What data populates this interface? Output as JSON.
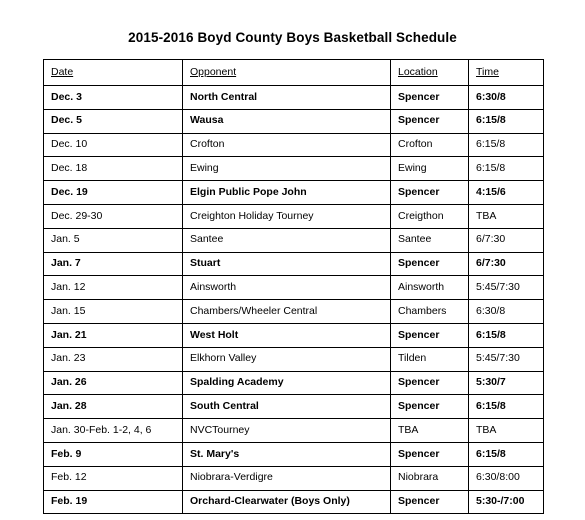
{
  "document": {
    "title": "2015-2016 Boyd County Boys Basketball Schedule"
  },
  "table": {
    "columns": [
      {
        "key": "date",
        "label": "Date"
      },
      {
        "key": "opponent",
        "label": "Opponent"
      },
      {
        "key": "location",
        "label": "Location"
      },
      {
        "key": "time",
        "label": "Time"
      }
    ],
    "rows": [
      {
        "date": "Dec. 3",
        "opponent": "North Central",
        "location": "Spencer",
        "time": "6:30/8",
        "home": true
      },
      {
        "date": "Dec. 5",
        "opponent": "Wausa",
        "location": "Spencer",
        "time": "6:15/8",
        "home": true
      },
      {
        "date": "Dec. 10",
        "opponent": "Crofton",
        "location": "Crofton",
        "time": "6:15/8",
        "home": false
      },
      {
        "date": "Dec. 18",
        "opponent": "Ewing",
        "location": "Ewing",
        "time": "6:15/8",
        "home": false
      },
      {
        "date": "Dec. 19",
        "opponent": "Elgin Public Pope John",
        "location": "Spencer",
        "time": "4:15/6",
        "home": true
      },
      {
        "date": "Dec. 29-30",
        "opponent": "Creighton Holiday Tourney",
        "location": "Creigthon",
        "time": "TBA",
        "home": false
      },
      {
        "date": "Jan. 5",
        "opponent": "Santee",
        "location": "Santee",
        "time": "6/7:30",
        "home": false
      },
      {
        "date": "Jan. 7",
        "opponent": "Stuart",
        "location": "Spencer",
        "time": "6/7:30",
        "home": true
      },
      {
        "date": "Jan. 12",
        "opponent": "Ainsworth",
        "location": "Ainsworth",
        "time": "5:45/7:30",
        "home": false
      },
      {
        "date": "Jan. 15",
        "opponent": "Chambers/Wheeler Central",
        "location": "Chambers",
        "time": "6:30/8",
        "home": false
      },
      {
        "date": "Jan. 21",
        "opponent": "West Holt",
        "location": "Spencer",
        "time": "6:15/8",
        "home": true
      },
      {
        "date": "Jan. 23",
        "opponent": "Elkhorn Valley",
        "location": "Tilden",
        "time": "5:45/7:30",
        "home": false
      },
      {
        "date": "Jan. 26",
        "opponent": "Spalding Academy",
        "location": "Spencer",
        "time": "5:30/7",
        "home": true
      },
      {
        "date": "Jan. 28",
        "opponent": "South Central",
        "location": "Spencer",
        "time": "6:15/8",
        "home": true
      },
      {
        "date": "Jan. 30-Feb. 1-2, 4, 6",
        "opponent": "NVCTourney",
        "location": "TBA",
        "time": "TBA",
        "home": false
      },
      {
        "date": "Feb. 9",
        "opponent": "St. Mary's",
        "location": "Spencer",
        "time": "6:15/8",
        "home": true
      },
      {
        "date": "Feb. 12",
        "opponent": "Niobrara-Verdigre",
        "location": "Niobrara",
        "time": "6:30/8:00",
        "home": false
      },
      {
        "date": "Feb. 19",
        "opponent": "Orchard-Clearwater (Boys Only)",
        "location": "Spencer",
        "time": "5:30-/7:00",
        "home": true
      }
    ]
  }
}
